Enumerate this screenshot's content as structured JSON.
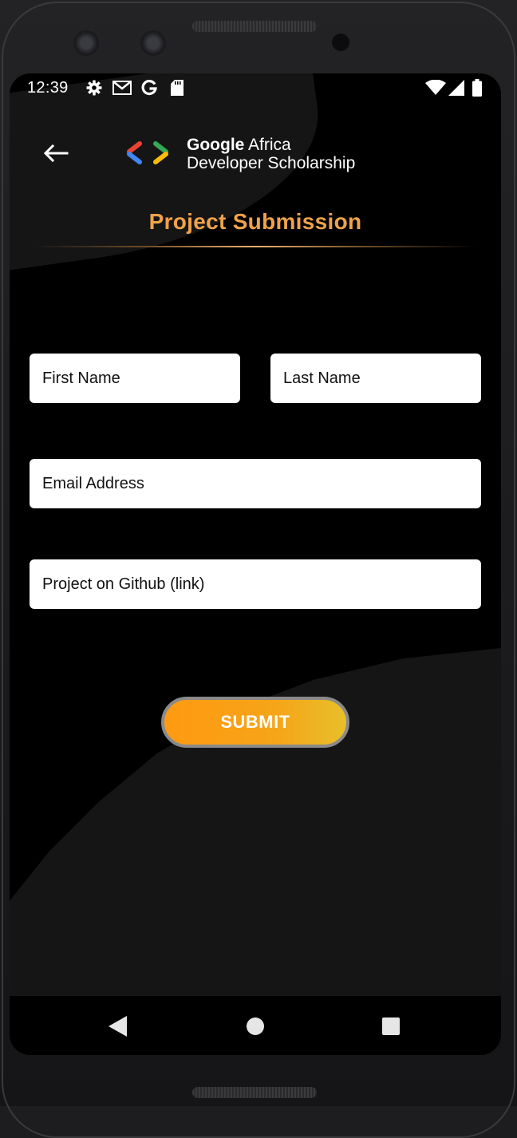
{
  "status_bar": {
    "time": "12:39",
    "icons": [
      "settings-icon",
      "gmail-icon",
      "google-icon",
      "sd-card-icon",
      "wifi-icon",
      "signal-icon",
      "battery-icon"
    ]
  },
  "header": {
    "back_icon": "arrow-left-icon",
    "logo": {
      "line1_bold": "Google",
      "line1_rest": " Africa",
      "line2": "Developer Scholarship"
    },
    "title": "Project Submission"
  },
  "form": {
    "first_name": {
      "value": "",
      "placeholder": "First Name"
    },
    "last_name": {
      "value": "",
      "placeholder": "Last Name"
    },
    "email": {
      "value": "",
      "placeholder": "Email Address"
    },
    "github": {
      "value": "",
      "placeholder": "Project on Github (link)"
    },
    "submit_label": "SUBMIT"
  },
  "nav_bar": {
    "icons": [
      "nav-back-icon",
      "nav-home-icon",
      "nav-recents-icon"
    ]
  },
  "colors": {
    "title": "#f0a24a",
    "submit_start": "#ff9a12",
    "submit_end": "#e8bf2a",
    "screen_bg": "#000000"
  }
}
